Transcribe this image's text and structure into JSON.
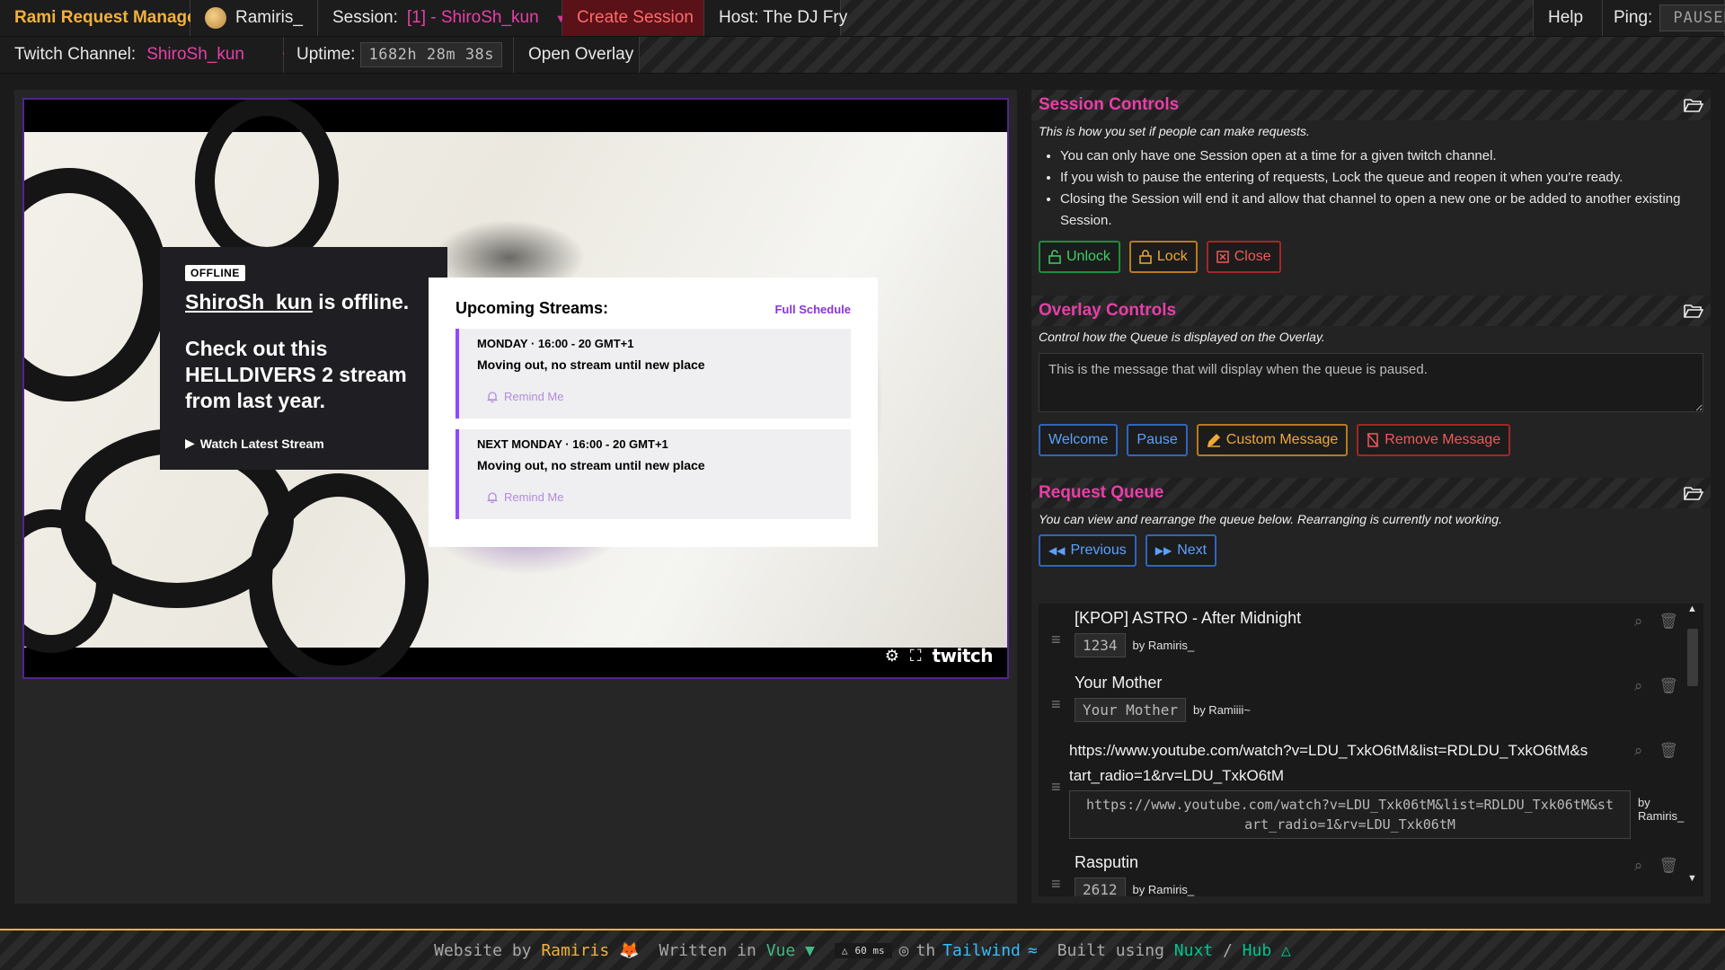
{
  "header": {
    "app_title": "Rami Request Manager",
    "user": "Ramiris_",
    "session_label": "Session:",
    "session_value": "[1] - ShiroSh_kun",
    "create_session": "Create Session",
    "host_label": "Host: The DJ Fry",
    "help": "Help",
    "ping_label": "Ping:",
    "ping_value": "PAUSED",
    "channel_label": "Twitch Channel:",
    "channel_value": "ShiroSh_kun",
    "uptime_label": "Uptime:",
    "uptime_value": "1682h 28m 38s",
    "open_overlay": "Open Overlay"
  },
  "player": {
    "offline_badge": "OFFLINE",
    "channel_name": "ShiroSh_kun",
    "offline_suffix": " is offline.",
    "promo_text": "Check out this HELLDIVERS 2 stream from last year.",
    "watch_latest": "Watch Latest Stream",
    "schedule_title": "Upcoming Streams:",
    "full_schedule": "Full Schedule",
    "schedule": [
      {
        "when": "MONDAY · 16:00 - 20 GMT+1",
        "desc": "Moving out, no stream until new place",
        "remind": "Remind Me"
      },
      {
        "when": "NEXT MONDAY · 16:00 - 20 GMT+1",
        "desc": "Moving out, no stream until new place",
        "remind": "Remind Me"
      }
    ],
    "brand": "twitch"
  },
  "session_controls": {
    "title": "Session Controls",
    "description": "This is how you set if people can make requests.",
    "bullets": [
      "You can only have one Session open at a time for a given twitch channel.",
      "If you wish to pause the entering of requests, Lock the queue and reopen it when you're ready.",
      "Closing the Session will end it and allow that channel to open a new one or be added to another existing Session."
    ],
    "unlock": "Unlock",
    "lock": "Lock",
    "close": "Close"
  },
  "overlay_controls": {
    "title": "Overlay Controls",
    "description": "Control how the Queue is displayed on the Overlay.",
    "message_placeholder": "This is the message that will display when the queue is paused.",
    "welcome": "Welcome",
    "pause": "Pause",
    "custom_message": "Custom Message",
    "remove_message": "Remove Message"
  },
  "request_queue": {
    "title": "Request Queue",
    "description": "You can view and rearrange the queue below. Rearranging is currently not working.",
    "previous": "Previous",
    "next": "Next",
    "items": [
      {
        "title": "[KPOP] ASTRO - After Midnight",
        "key": "1234",
        "by": "by Ramiris_"
      },
      {
        "title": "Your Mother",
        "key": "Your Mother",
        "by": "by Ramiiii~"
      },
      {
        "title": "https://www.youtube.com/watch?v=LDU_TxkO6tM&list=RDLDU_TxkO6tM&start_radio=1&rv=LDU_TxkO6tM",
        "key": "https://www.youtube.com/watch?v=LDU_Txk06tM&list=RDLDU_Txk06tM&start_radio=1&rv=LDU_Txk06tM",
        "by": "by Ramiris_"
      },
      {
        "title": "Rasputin",
        "key": "2612",
        "by": "by Ramiris_"
      }
    ]
  },
  "footer": {
    "website_by": "Website by",
    "author": "Ramiris",
    "written_in": "Written in",
    "vue": "Vue",
    "fps": "60 ms",
    "with_prefix": "th",
    "tailwind": "Tailwind",
    "built_using": "Built using",
    "nuxt": "Nuxt",
    "slash": "/",
    "hub": "Hub"
  },
  "colors": {
    "accent_pink": "#e83fa7",
    "accent_gold": "#f2b13d",
    "twitch_purple": "#9147ff"
  },
  "icons": [
    "chevron-down-icon",
    "folder-open-icon",
    "unlock-icon",
    "lock-icon",
    "close-square-icon",
    "pencil-icon",
    "remove-message-icon",
    "rewind-icon",
    "fast-forward-icon",
    "search-queue-icon",
    "trash-icon",
    "drag-handle-icon",
    "gear-icon",
    "fullscreen-icon",
    "bell-icon",
    "play-icon"
  ]
}
